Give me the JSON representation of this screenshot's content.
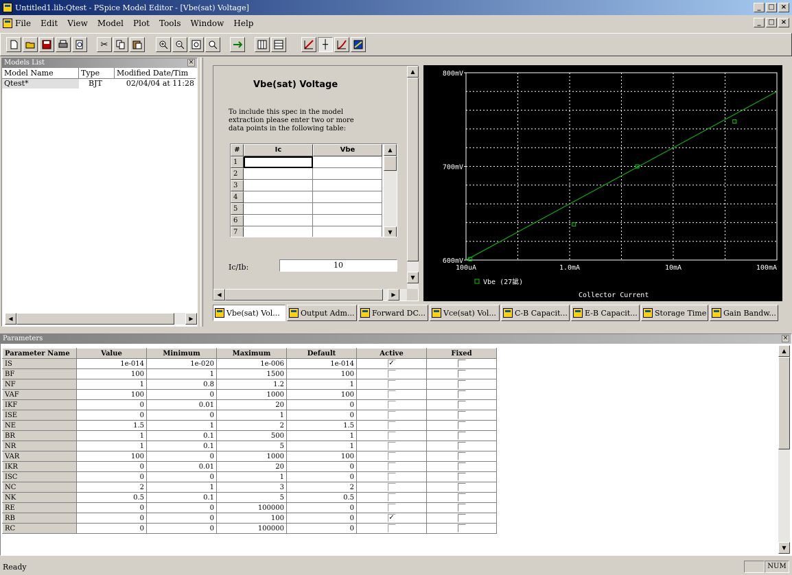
{
  "titlebar": {
    "title": "Untitled1.lib:Qtest - PSpice Model Editor - [Vbe(sat) Voltage]"
  },
  "menubar": {
    "items": [
      "File",
      "Edit",
      "View",
      "Model",
      "Plot",
      "Tools",
      "Window",
      "Help"
    ]
  },
  "models_list": {
    "title": "Models List",
    "columns": [
      "Model Name",
      "Type",
      "Modified Date/Tim"
    ],
    "rows": [
      {
        "name": "Qtest*",
        "type": "BJT",
        "modified": "02/04/04 at 11:28"
      }
    ]
  },
  "spec": {
    "title": "Vbe(sat) Voltage",
    "instructions": "To include this spec in the model extraction please enter two or more data points in the following table:",
    "table_headers": [
      "#",
      "Ic",
      "Vbe"
    ],
    "row_numbers": [
      "1",
      "2",
      "3",
      "4",
      "5",
      "6",
      "7"
    ],
    "ratio_label": "Ic/Ib:",
    "ratio_value": "10"
  },
  "chart_data": {
    "type": "line",
    "title": "",
    "xlabel": "Collector Current",
    "ylabel": "",
    "x_scale": "log",
    "x_ticks": [
      "100uA",
      "1.0mA",
      "10mA",
      "100mA"
    ],
    "y_ticks": [
      "600mV",
      "700mV",
      "800mV"
    ],
    "xlim": [
      0.0001,
      0.1
    ],
    "ylim": [
      0.6,
      0.8
    ],
    "grid": true,
    "legend": "Vbe (27訿)",
    "series": [
      {
        "name": "Vbe (27訿)",
        "x": [
          0.0001,
          0.1
        ],
        "y": [
          0.6,
          0.78
        ]
      }
    ],
    "markers": {
      "x": [
        0.00011,
        0.0011,
        0.0045,
        0.039
      ],
      "y": [
        0.601,
        0.638,
        0.7,
        0.748
      ]
    },
    "colors": {
      "background": "#000000",
      "line": "#00cc00",
      "grid": "#ffffff",
      "text": "#ffffff"
    }
  },
  "tabs": [
    "Vbe(sat) Vol...",
    "Output Adm...",
    "Forward DC...",
    "Vce(sat) Vol...",
    "C-B Capacit...",
    "E-B Capacit...",
    "Storage Time",
    "Gain Bandw..."
  ],
  "parameters": {
    "title": "Parameters",
    "columns": [
      "Parameter Name",
      "Value",
      "Minimum",
      "Maximum",
      "Default",
      "Active",
      "Fixed"
    ],
    "rows": [
      {
        "name": "IS",
        "value": "1e-014",
        "min": "1e-020",
        "max": "1e-006",
        "def": "1e-014",
        "active": true,
        "fixed": false
      },
      {
        "name": "BF",
        "value": "100",
        "min": "1",
        "max": "1500",
        "def": "100",
        "active": false,
        "fixed": false
      },
      {
        "name": "NF",
        "value": "1",
        "min": "0.8",
        "max": "1.2",
        "def": "1",
        "active": false,
        "fixed": false
      },
      {
        "name": "VAF",
        "value": "100",
        "min": "0",
        "max": "1000",
        "def": "100",
        "active": false,
        "fixed": false
      },
      {
        "name": "IKF",
        "value": "0",
        "min": "0.01",
        "max": "20",
        "def": "0",
        "active": false,
        "fixed": false
      },
      {
        "name": "ISE",
        "value": "0",
        "min": "0",
        "max": "1",
        "def": "0",
        "active": false,
        "fixed": false
      },
      {
        "name": "NE",
        "value": "1.5",
        "min": "1",
        "max": "2",
        "def": "1.5",
        "active": false,
        "fixed": false
      },
      {
        "name": "BR",
        "value": "1",
        "min": "0.1",
        "max": "500",
        "def": "1",
        "active": false,
        "fixed": false
      },
      {
        "name": "NR",
        "value": "1",
        "min": "0.1",
        "max": "5",
        "def": "1",
        "active": false,
        "fixed": false
      },
      {
        "name": "VAR",
        "value": "100",
        "min": "0",
        "max": "1000",
        "def": "100",
        "active": false,
        "fixed": false
      },
      {
        "name": "IKR",
        "value": "0",
        "min": "0.01",
        "max": "20",
        "def": "0",
        "active": false,
        "fixed": false
      },
      {
        "name": "ISC",
        "value": "0",
        "min": "0",
        "max": "1",
        "def": "0",
        "active": false,
        "fixed": false
      },
      {
        "name": "NC",
        "value": "2",
        "min": "1",
        "max": "3",
        "def": "2",
        "active": false,
        "fixed": false
      },
      {
        "name": "NK",
        "value": "0.5",
        "min": "0.1",
        "max": "5",
        "def": "0.5",
        "active": false,
        "fixed": false
      },
      {
        "name": "RE",
        "value": "0",
        "min": "0",
        "max": "100000",
        "def": "0",
        "active": false,
        "fixed": false
      },
      {
        "name": "RB",
        "value": "0",
        "min": "0",
        "max": "100",
        "def": "0",
        "active": true,
        "fixed": false
      },
      {
        "name": "RC",
        "value": "0",
        "min": "0",
        "max": "100000",
        "def": "0",
        "active": false,
        "fixed": false
      }
    ]
  },
  "statusbar": {
    "text": "Ready",
    "num": "NUM"
  }
}
